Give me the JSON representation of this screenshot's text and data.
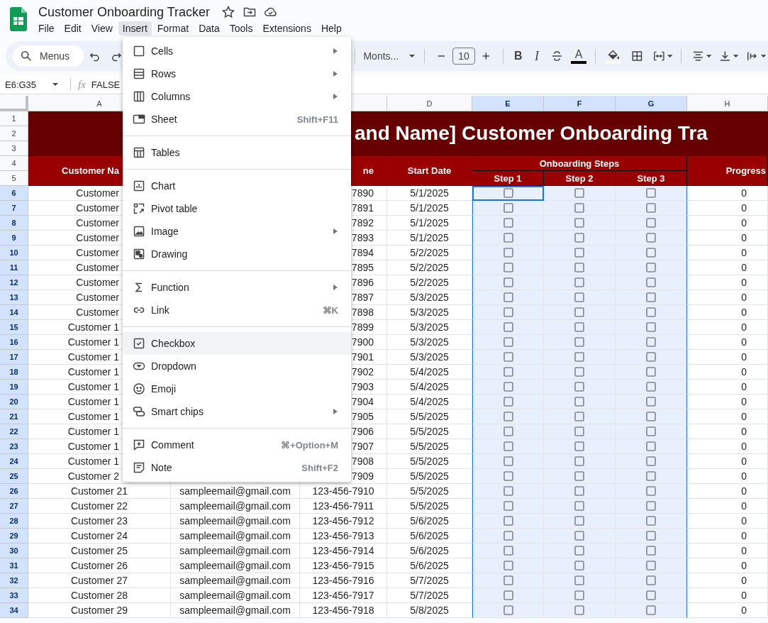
{
  "document": {
    "title": "Customer Onboarding Tracker"
  },
  "menubar": [
    {
      "label": "File",
      "selected": false
    },
    {
      "label": "Edit",
      "selected": false
    },
    {
      "label": "View",
      "selected": false
    },
    {
      "label": "Insert",
      "selected": true
    },
    {
      "label": "Format",
      "selected": false
    },
    {
      "label": "Data",
      "selected": false
    },
    {
      "label": "Tools",
      "selected": false
    },
    {
      "label": "Extensions",
      "selected": false
    },
    {
      "label": "Help",
      "selected": false
    }
  ],
  "toolbar": {
    "search": {
      "placeholder": "Menus"
    },
    "font": "Monts...",
    "font_size": "10",
    "bold": "B",
    "italic": "I",
    "text_color": "A"
  },
  "formula_bar": {
    "cell_range": "E6:G35",
    "fx": "fx",
    "value": "FALSE"
  },
  "columns": [
    {
      "label": "A",
      "selected": false
    },
    {
      "selected": false
    },
    {
      "label": "D",
      "selected": false
    },
    {
      "label": "E",
      "selected": true
    },
    {
      "label": "F",
      "selected": true
    },
    {
      "label": "G",
      "selected": true
    },
    {
      "label": "H",
      "selected": false
    }
  ],
  "top_rows": [
    {
      "n": "1",
      "selected": false
    },
    {
      "n": "2",
      "selected": false
    },
    {
      "n": "3",
      "selected": false
    },
    {
      "n": "4",
      "selected": false
    },
    {
      "n": "5",
      "selected": false
    }
  ],
  "table_header": {
    "title": "and Name] Customer Onboarding Tra",
    "customer": "Customer Na",
    "phone": "ne",
    "start_date": "Start Date",
    "group": "Onboarding Steps",
    "steps": [
      "Step 1",
      "Step 2",
      "Step 3"
    ],
    "progress": "Progress"
  },
  "rows": [
    {
      "n": "6",
      "selected": true,
      "name": "Customer",
      "phone": "7890",
      "date": "5/1/2025",
      "steps": [
        {
          "checked": false,
          "active": true
        },
        {
          "checked": false,
          "active": false
        },
        {
          "checked": false,
          "active": false
        }
      ],
      "progress": "0"
    },
    {
      "n": "7",
      "selected": true,
      "name": "Customer",
      "phone": "7891",
      "date": "5/1/2025",
      "steps": [
        {
          "checked": false,
          "active": false
        },
        {
          "checked": false,
          "active": false
        },
        {
          "checked": false,
          "active": false
        }
      ],
      "progress": "0"
    },
    {
      "n": "8",
      "selected": true,
      "name": "Customer",
      "phone": "7892",
      "date": "5/1/2025",
      "steps": [
        {
          "checked": false,
          "active": false
        },
        {
          "checked": false,
          "active": false
        },
        {
          "checked": false,
          "active": false
        }
      ],
      "progress": "0"
    },
    {
      "n": "9",
      "selected": true,
      "name": "Customer",
      "phone": "7893",
      "date": "5/1/2025",
      "steps": [
        {
          "checked": false,
          "active": false
        },
        {
          "checked": false,
          "active": false
        },
        {
          "checked": false,
          "active": false
        }
      ],
      "progress": "0"
    },
    {
      "n": "10",
      "selected": true,
      "name": "Customer",
      "phone": "7894",
      "date": "5/2/2025",
      "steps": [
        {
          "checked": false,
          "active": false
        },
        {
          "checked": false,
          "active": false
        },
        {
          "checked": false,
          "active": false
        }
      ],
      "progress": "0"
    },
    {
      "n": "11",
      "selected": true,
      "name": "Customer",
      "phone": "7895",
      "date": "5/2/2025",
      "steps": [
        {
          "checked": false,
          "active": false
        },
        {
          "checked": false,
          "active": false
        },
        {
          "checked": false,
          "active": false
        }
      ],
      "progress": "0"
    },
    {
      "n": "12",
      "selected": true,
      "name": "Customer",
      "phone": "7896",
      "date": "5/2/2025",
      "steps": [
        {
          "checked": false,
          "active": false
        },
        {
          "checked": false,
          "active": false
        },
        {
          "checked": false,
          "active": false
        }
      ],
      "progress": "0"
    },
    {
      "n": "13",
      "selected": true,
      "name": "Customer",
      "phone": "7897",
      "date": "5/3/2025",
      "steps": [
        {
          "checked": false,
          "active": false
        },
        {
          "checked": false,
          "active": false
        },
        {
          "checked": false,
          "active": false
        }
      ],
      "progress": "0"
    },
    {
      "n": "14",
      "selected": true,
      "name": "Customer",
      "phone": "7898",
      "date": "5/3/2025",
      "steps": [
        {
          "checked": false,
          "active": false
        },
        {
          "checked": false,
          "active": false
        },
        {
          "checked": false,
          "active": false
        }
      ],
      "progress": "0"
    },
    {
      "n": "15",
      "selected": true,
      "name": "Customer 1",
      "phone": "7899",
      "date": "5/3/2025",
      "steps": [
        {
          "checked": false,
          "active": false
        },
        {
          "checked": false,
          "active": false
        },
        {
          "checked": false,
          "active": false
        }
      ],
      "progress": "0"
    },
    {
      "n": "16",
      "selected": true,
      "name": "Customer 1",
      "phone": "7900",
      "date": "5/3/2025",
      "steps": [
        {
          "checked": false,
          "active": false
        },
        {
          "checked": false,
          "active": false
        },
        {
          "checked": false,
          "active": false
        }
      ],
      "progress": "0"
    },
    {
      "n": "17",
      "selected": true,
      "name": "Customer 1",
      "phone": "7901",
      "date": "5/3/2025",
      "steps": [
        {
          "checked": false,
          "active": false
        },
        {
          "checked": false,
          "active": false
        },
        {
          "checked": false,
          "active": false
        }
      ],
      "progress": "0"
    },
    {
      "n": "18",
      "selected": true,
      "name": "Customer 1",
      "phone": "7902",
      "date": "5/4/2025",
      "steps": [
        {
          "checked": false,
          "active": false
        },
        {
          "checked": false,
          "active": false
        },
        {
          "checked": false,
          "active": false
        }
      ],
      "progress": "0"
    },
    {
      "n": "19",
      "selected": true,
      "name": "Customer 1",
      "phone": "7903",
      "date": "5/4/2025",
      "steps": [
        {
          "checked": false,
          "active": false
        },
        {
          "checked": false,
          "active": false
        },
        {
          "checked": false,
          "active": false
        }
      ],
      "progress": "0"
    },
    {
      "n": "20",
      "selected": true,
      "name": "Customer 1",
      "phone": "7904",
      "date": "5/4/2025",
      "steps": [
        {
          "checked": false,
          "active": false
        },
        {
          "checked": false,
          "active": false
        },
        {
          "checked": false,
          "active": false
        }
      ],
      "progress": "0"
    },
    {
      "n": "21",
      "selected": true,
      "name": "Customer 1",
      "phone": "7905",
      "date": "5/5/2025",
      "steps": [
        {
          "checked": false,
          "active": false
        },
        {
          "checked": false,
          "active": false
        },
        {
          "checked": false,
          "active": false
        }
      ],
      "progress": "0"
    },
    {
      "n": "22",
      "selected": true,
      "name": "Customer 1",
      "phone": "7906",
      "date": "5/5/2025",
      "steps": [
        {
          "checked": false,
          "active": false
        },
        {
          "checked": false,
          "active": false
        },
        {
          "checked": false,
          "active": false
        }
      ],
      "progress": "0"
    },
    {
      "n": "23",
      "selected": true,
      "name": "Customer 1",
      "phone": "7907",
      "date": "5/5/2025",
      "steps": [
        {
          "checked": false,
          "active": false
        },
        {
          "checked": false,
          "active": false
        },
        {
          "checked": false,
          "active": false
        }
      ],
      "progress": "0"
    },
    {
      "n": "24",
      "selected": true,
      "name": "Customer 1",
      "phone": "7908",
      "date": "5/5/2025",
      "steps": [
        {
          "checked": false,
          "active": false
        },
        {
          "checked": false,
          "active": false
        },
        {
          "checked": false,
          "active": false
        }
      ],
      "progress": "0"
    },
    {
      "n": "25",
      "selected": true,
      "name": "Customer 2",
      "phone": "7909",
      "date": "5/5/2025",
      "steps": [
        {
          "checked": false,
          "active": false
        },
        {
          "checked": false,
          "active": false
        },
        {
          "checked": false,
          "active": false
        }
      ],
      "progress": "0"
    },
    {
      "n": "26",
      "selected": true,
      "name": "Customer 21",
      "email": "sampleemail@gmail.com",
      "phone": "123-456-7910",
      "date": "5/5/2025",
      "steps": [
        {
          "checked": false,
          "active": false
        },
        {
          "checked": false,
          "active": false
        },
        {
          "checked": false,
          "active": false
        }
      ],
      "progress": "0"
    },
    {
      "n": "27",
      "selected": true,
      "name": "Customer 22",
      "email": "sampleemail@gmail.com",
      "phone": "123-456-7911",
      "date": "5/5/2025",
      "steps": [
        {
          "checked": false,
          "active": false
        },
        {
          "checked": false,
          "active": false
        },
        {
          "checked": false,
          "active": false
        }
      ],
      "progress": "0"
    },
    {
      "n": "28",
      "selected": true,
      "name": "Customer 23",
      "email": "sampleemail@gmail.com",
      "phone": "123-456-7912",
      "date": "5/6/2025",
      "steps": [
        {
          "checked": false,
          "active": false
        },
        {
          "checked": false,
          "active": false
        },
        {
          "checked": false,
          "active": false
        }
      ],
      "progress": "0"
    },
    {
      "n": "29",
      "selected": true,
      "name": "Customer 24",
      "email": "sampleemail@gmail.com",
      "phone": "123-456-7913",
      "date": "5/6/2025",
      "steps": [
        {
          "checked": false,
          "active": false
        },
        {
          "checked": false,
          "active": false
        },
        {
          "checked": false,
          "active": false
        }
      ],
      "progress": "0"
    },
    {
      "n": "30",
      "selected": true,
      "name": "Customer 25",
      "email": "sampleemail@gmail.com",
      "phone": "123-456-7914",
      "date": "5/6/2025",
      "steps": [
        {
          "checked": false,
          "active": false
        },
        {
          "checked": false,
          "active": false
        },
        {
          "checked": false,
          "active": false
        }
      ],
      "progress": "0"
    },
    {
      "n": "31",
      "selected": true,
      "name": "Customer 26",
      "email": "sampleemail@gmail.com",
      "phone": "123-456-7915",
      "date": "5/6/2025",
      "steps": [
        {
          "checked": false,
          "active": false
        },
        {
          "checked": false,
          "active": false
        },
        {
          "checked": false,
          "active": false
        }
      ],
      "progress": "0"
    },
    {
      "n": "32",
      "selected": true,
      "name": "Customer 27",
      "email": "sampleemail@gmail.com",
      "phone": "123-456-7916",
      "date": "5/7/2025",
      "steps": [
        {
          "checked": false,
          "active": false
        },
        {
          "checked": false,
          "active": false
        },
        {
          "checked": false,
          "active": false
        }
      ],
      "progress": "0"
    },
    {
      "n": "33",
      "selected": true,
      "name": "Customer 28",
      "email": "sampleemail@gmail.com",
      "phone": "123-456-7917",
      "date": "5/7/2025",
      "steps": [
        {
          "checked": false,
          "active": false
        },
        {
          "checked": false,
          "active": false
        },
        {
          "checked": false,
          "active": false
        }
      ],
      "progress": "0"
    },
    {
      "n": "34",
      "selected": true,
      "name": "Customer 29",
      "email": "sampleemail@gmail.com",
      "phone": "123-456-7918",
      "date": "5/8/2025",
      "steps": [
        {
          "checked": false,
          "active": false
        },
        {
          "checked": false,
          "active": false
        },
        {
          "checked": false,
          "active": false
        }
      ],
      "progress": "0"
    }
  ],
  "insert_menu": {
    "items": [
      {
        "kind": "item",
        "label": "Cells",
        "submenu": true,
        "selected": false
      },
      {
        "kind": "item",
        "label": "Rows",
        "submenu": true,
        "selected": false
      },
      {
        "kind": "item",
        "label": "Columns",
        "submenu": true,
        "selected": false
      },
      {
        "kind": "item",
        "label": "Sheet",
        "shortcut": "Shift+F11",
        "submenu": false,
        "selected": false
      },
      {
        "kind": "separator"
      },
      {
        "kind": "item",
        "label": "Tables",
        "submenu": false,
        "selected": false
      },
      {
        "kind": "separator"
      },
      {
        "kind": "item",
        "label": "Chart",
        "submenu": false,
        "selected": false
      },
      {
        "kind": "item",
        "label": "Pivot table",
        "submenu": false,
        "selected": false
      },
      {
        "kind": "item",
        "label": "Image",
        "submenu": true,
        "selected": false
      },
      {
        "kind": "item",
        "label": "Drawing",
        "submenu": false,
        "selected": false
      },
      {
        "kind": "separator"
      },
      {
        "kind": "item",
        "label": "Function",
        "submenu": true,
        "selected": false
      },
      {
        "kind": "item",
        "label": "Link",
        "shortcut": "⌘K",
        "submenu": false,
        "selected": false
      },
      {
        "kind": "separator"
      },
      {
        "kind": "item",
        "label": "Checkbox",
        "submenu": false,
        "selected": true
      },
      {
        "kind": "item",
        "label": "Dropdown",
        "submenu": false,
        "selected": false
      },
      {
        "kind": "item",
        "label": "Emoji",
        "submenu": false,
        "selected": false
      },
      {
        "kind": "item",
        "label": "Smart chips",
        "submenu": true,
        "selected": false
      },
      {
        "kind": "separator"
      },
      {
        "kind": "item",
        "label": "Comment",
        "shortcut": "⌘+Option+M",
        "submenu": false,
        "selected": false
      },
      {
        "kind": "item",
        "label": "Note",
        "shortcut": "Shift+F2",
        "submenu": false,
        "selected": false
      }
    ]
  }
}
